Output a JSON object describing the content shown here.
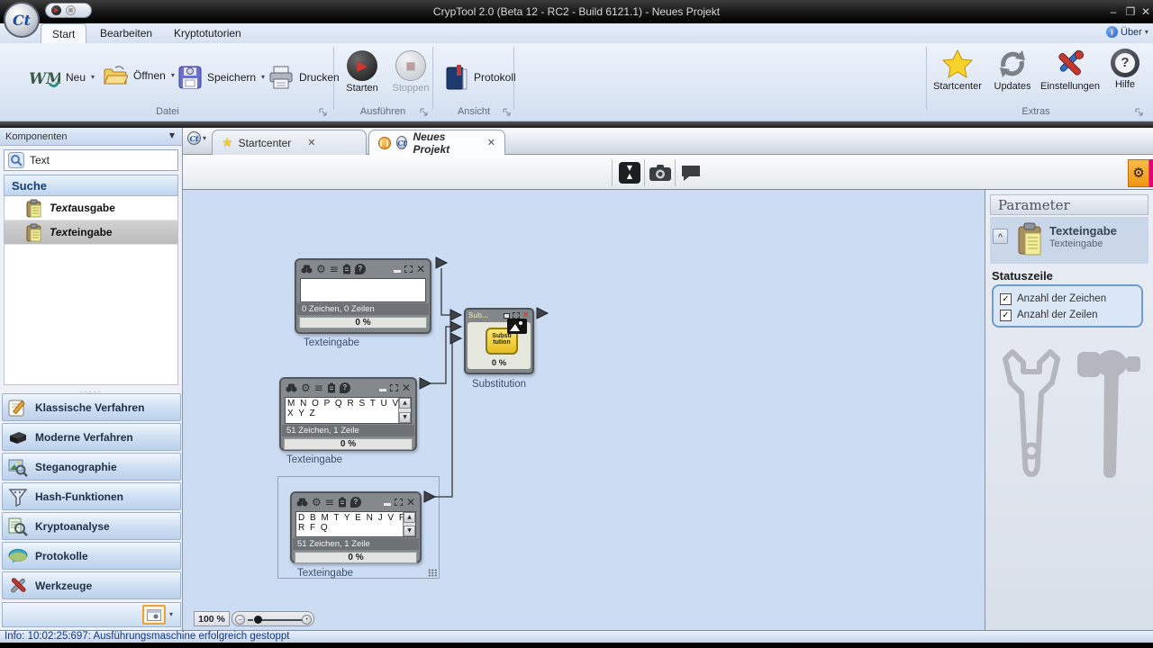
{
  "window": {
    "title": "CrypTool 2.0 (Beta 12 - RC2 - Build 6121.1) - Neues Projekt",
    "minimize": "–",
    "maximize": "❐",
    "close": "✕",
    "about": "Über"
  },
  "ribbon": {
    "tabs": [
      "Start",
      "Bearbeiten",
      "Kryptotutorien"
    ],
    "datei": {
      "label": "Datei",
      "neu": "Neu",
      "oeffnen": "Öffnen",
      "speichern": "Speichern",
      "drucken": "Drucken"
    },
    "ausfuehren": {
      "label": "Ausführen",
      "starten": "Starten",
      "stoppen": "Stoppen"
    },
    "ansicht": {
      "label": "Ansicht",
      "protokoll": "Protokoll"
    },
    "extras": {
      "label": "Extras",
      "startcenter": "Startcenter",
      "updates": "Updates",
      "einstellungen": "Einstellungen",
      "hilfe": "Hilfe"
    }
  },
  "sidebar": {
    "header": "Komponenten",
    "search_value": "Text",
    "section_suche": "Suche",
    "results": [
      {
        "em": "Text",
        "rest": "ausgabe"
      },
      {
        "em": "Text",
        "rest": "eingabe"
      }
    ],
    "categories": [
      "Klassische Verfahren",
      "Moderne Verfahren",
      "Steganographie",
      "Hash-Funktionen",
      "Kryptoanalyse",
      "Protokolle",
      "Werkzeuge"
    ]
  },
  "doc_tabs": {
    "tab1": "Startcenter",
    "tab2": "Neues Projekt"
  },
  "canvas": {
    "zoom": "100 %",
    "node1": {
      "status": "0 Zeichen,  0 Zeilen",
      "progress": "0 %",
      "caption": "Texteingabe"
    },
    "node2": {
      "line1": "M N O P Q R S T U V W",
      "line2": "X Y Z",
      "status": "51 Zeichen,  1 Zeile",
      "progress": "0 %",
      "caption": "Texteingabe"
    },
    "node3": {
      "line1": "D B M T Y E N J V P O T",
      "line2": "R F Q",
      "status": "51 Zeichen,  1 Zeile",
      "progress": "0 %",
      "caption": "Texteingabe"
    },
    "subst": {
      "title": "Sub...",
      "icon_line1": "Substi",
      "icon_line2": "tution",
      "progress": "0 %",
      "caption": "Substitution"
    }
  },
  "params": {
    "header": "Parameter",
    "title": "Texteingabe",
    "subtitle": "Texteingabe",
    "section": "Statuszeile",
    "cb1": "Anzahl der Zeichen",
    "cb2": "Anzahl der Zeilen"
  },
  "statusbar": "Info: 10:02:25:697: Ausführungsmaschine erfolgreich gestoppt",
  "icons": {
    "gear": "⚙",
    "menu": "≡",
    "close": "✕",
    "min": "–",
    "caret": "▾",
    "caret_down": "▼",
    "star": "★",
    "check": "✓",
    "question": "?",
    "info": "i",
    "up": "▲",
    "down": "▼",
    "pause": "❙❙",
    "collapse": "^",
    "logo": "Ct",
    "play": "▶",
    "stop": "■",
    "plus": "+",
    "minus": "–"
  },
  "colors": {
    "accent_orange": "#f5a623",
    "accent_pink": "#e6007e",
    "canvas_bg": "#cbdcf3",
    "node_yellow": "#f2cd3a"
  }
}
